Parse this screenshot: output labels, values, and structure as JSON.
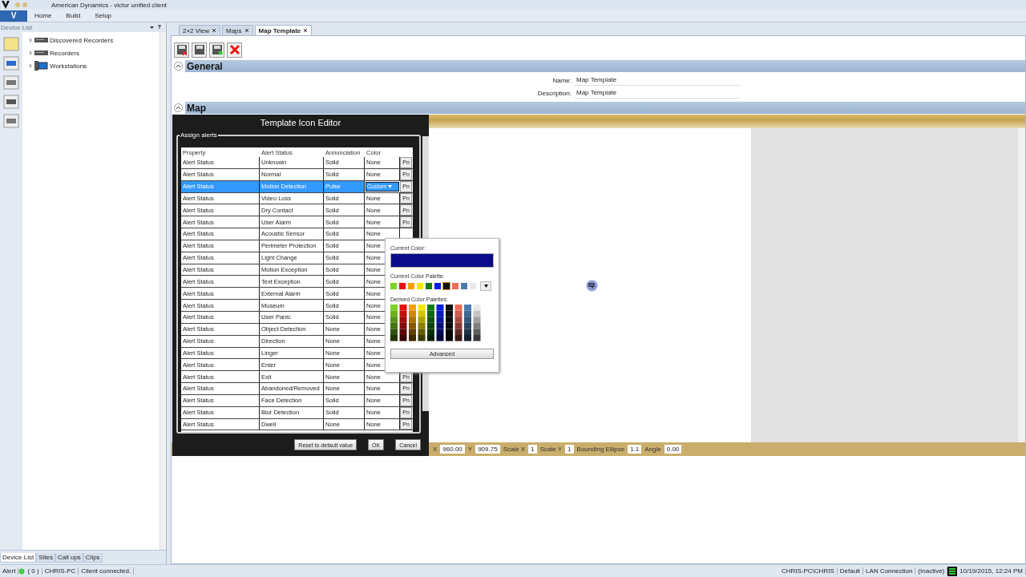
{
  "window": {
    "title": "American Dynamics - victor unified client"
  },
  "menu": {
    "app_button": "V",
    "items": [
      "Home",
      "Build",
      "Setup"
    ]
  },
  "sidebar": {
    "title": "Device List",
    "tree": [
      {
        "label": "Discovered Recorders",
        "kind": "recorder",
        "expanded": false
      },
      {
        "label": "Recorders",
        "kind": "recorder",
        "expanded": false
      },
      {
        "label": "Workstations",
        "kind": "workstation",
        "expanded": false
      }
    ],
    "bottom_tabs": [
      {
        "label": "Device List",
        "selected": true
      },
      {
        "label": "Sites",
        "selected": false
      },
      {
        "label": "Call ups",
        "selected": false
      },
      {
        "label": "Clips",
        "selected": false
      }
    ]
  },
  "tabs": [
    {
      "label": "2×2 View",
      "selected": false
    },
    {
      "label": "Maps",
      "selected": false
    },
    {
      "label": "Map Template",
      "selected": true
    }
  ],
  "general": {
    "title": "General",
    "expanded": true,
    "fields": [
      {
        "label": "Name:",
        "value": "Map Template"
      },
      {
        "label": "Description:",
        "value": "Map Template"
      }
    ]
  },
  "map": {
    "title": "Map",
    "expanded": true
  },
  "editor": {
    "title": "Template Icon Editor",
    "group": "Assign alerts",
    "columns": [
      "Property",
      "Alert Status",
      "Annunciation",
      "Color"
    ],
    "rows": [
      {
        "property": "Alert Status",
        "alert_status": "Unknown",
        "annunciation": "Solid",
        "color_setting": "None",
        "button": "Pn",
        "selected": false
      },
      {
        "property": "Alert Status",
        "alert_status": "Normal",
        "annunciation": "Solid",
        "color_setting": "None",
        "button": "Pn",
        "selected": false
      },
      {
        "property": "Alert Status",
        "alert_status": "Motion Detection",
        "annunciation": "Pulse",
        "color_setting": "Custom",
        "button": "Pn",
        "selected": true
      },
      {
        "property": "Alert Status",
        "alert_status": "Video Loss",
        "annunciation": "Solid",
        "color_setting": "None",
        "button": "Pn",
        "selected": false
      },
      {
        "property": "Alert Status",
        "alert_status": "Dry Contact",
        "annunciation": "Solid",
        "color_setting": "None",
        "button": "Pn",
        "selected": false
      },
      {
        "property": "Alert Status",
        "alert_status": "User Alarm",
        "annunciation": "Solid",
        "color_setting": "None",
        "button": "Pn",
        "selected": false
      },
      {
        "property": "Alert Status",
        "alert_status": "Acoustic Sensor",
        "annunciation": "Solid",
        "color_setting": "None",
        "selected": false
      },
      {
        "property": "Alert Status",
        "alert_status": "Perimeter Protection",
        "annunciation": "Solid",
        "color_setting": "None",
        "selected": false
      },
      {
        "property": "Alert Status",
        "alert_status": "Light Change",
        "annunciation": "Solid",
        "color_setting": "None",
        "selected": false
      },
      {
        "property": "Alert Status",
        "alert_status": "Motion Exception",
        "annunciation": "Solid",
        "color_setting": "None",
        "selected": false
      },
      {
        "property": "Alert Status",
        "alert_status": "Text Exception",
        "annunciation": "Solid",
        "color_setting": "None",
        "selected": false
      },
      {
        "property": "Alert Status",
        "alert_status": "External Alarm",
        "annunciation": "Solid",
        "color_setting": "None",
        "selected": false
      },
      {
        "property": "Alert Status",
        "alert_status": "Museum",
        "annunciation": "Solid",
        "color_setting": "None",
        "selected": false
      },
      {
        "property": "Alert Status",
        "alert_status": "User Panic",
        "annunciation": "Solid",
        "color_setting": "None",
        "selected": false
      },
      {
        "property": "Alert Status",
        "alert_status": "Object Detection",
        "annunciation": "None",
        "color_setting": "None",
        "selected": false
      },
      {
        "property": "Alert Status",
        "alert_status": "Direction",
        "annunciation": "None",
        "color_setting": "None",
        "selected": false
      },
      {
        "property": "Alert Status",
        "alert_status": "Linger",
        "annunciation": "None",
        "color_setting": "None",
        "selected": false
      },
      {
        "property": "Alert Status",
        "alert_status": "Enter",
        "annunciation": "None",
        "color_setting": "None",
        "selected": false
      },
      {
        "property": "Alert Status",
        "alert_status": "Exit",
        "annunciation": "None",
        "color_setting": "None",
        "button": "Pn",
        "selected": false
      },
      {
        "property": "Alert Status",
        "alert_status": "Abandoned/Removed",
        "annunciation": "None",
        "color_setting": "None",
        "button": "Pn",
        "selected": false
      },
      {
        "property": "Alert Status",
        "alert_status": "Face Detection",
        "annunciation": "Solid",
        "color_setting": "None",
        "button": "Pn",
        "selected": false
      },
      {
        "property": "Alert Status",
        "alert_status": "Blur Detection",
        "annunciation": "Solid",
        "color_setting": "None",
        "button": "Pn",
        "selected": false
      },
      {
        "property": "Alert Status",
        "alert_status": "Dwell",
        "annunciation": "None",
        "color_setting": "None",
        "button": "Pn",
        "selected": false
      }
    ],
    "buttons": [
      "Reset to default value",
      "OK",
      "Cancel"
    ]
  },
  "color_picker": {
    "current_label": "Current Color:",
    "current": {
      "color": "#0c0c8a"
    },
    "palette_label": "Current Color Palette:",
    "palette": [
      {
        "color": "#7ed321",
        "selected": false
      },
      {
        "color": "#e81010",
        "selected": false
      },
      {
        "color": "#f5a000",
        "selected": false
      },
      {
        "color": "#f5e800",
        "selected": false
      },
      {
        "color": "#177a17",
        "selected": false
      },
      {
        "color": "#0a1ee0",
        "selected": false
      },
      {
        "color": "#111111",
        "selected": true
      },
      {
        "color": "#f06a5a",
        "selected": false
      },
      {
        "color": "#4a7cb0",
        "selected": false
      },
      {
        "color": "#e8e8e8",
        "selected": false
      }
    ],
    "derived_label": "Derived Color Palettes:",
    "advanced": "Advanced"
  },
  "properties_bar": [
    {
      "label": "X",
      "value": "960.00"
    },
    {
      "label": "Y",
      "value": "909.75"
    },
    {
      "label": "Scale X",
      "value": "1"
    },
    {
      "label": "Scale Y",
      "value": "1"
    },
    {
      "label": "Bounding Ellipse",
      "value": "1.1"
    },
    {
      "label": "Angle",
      "value": "0.00"
    }
  ],
  "status_bar": {
    "alert": "Alert",
    "alert_count": "( 0 )",
    "host": "CHRIS-PC",
    "message": "Client connected.",
    "user": "CHRIS-PC\\CHRIS",
    "profile": "Default",
    "connection": "LAN Connection",
    "connection_state": "(Inactive)",
    "datetime": "10/19/2015, 12:24 PM"
  }
}
